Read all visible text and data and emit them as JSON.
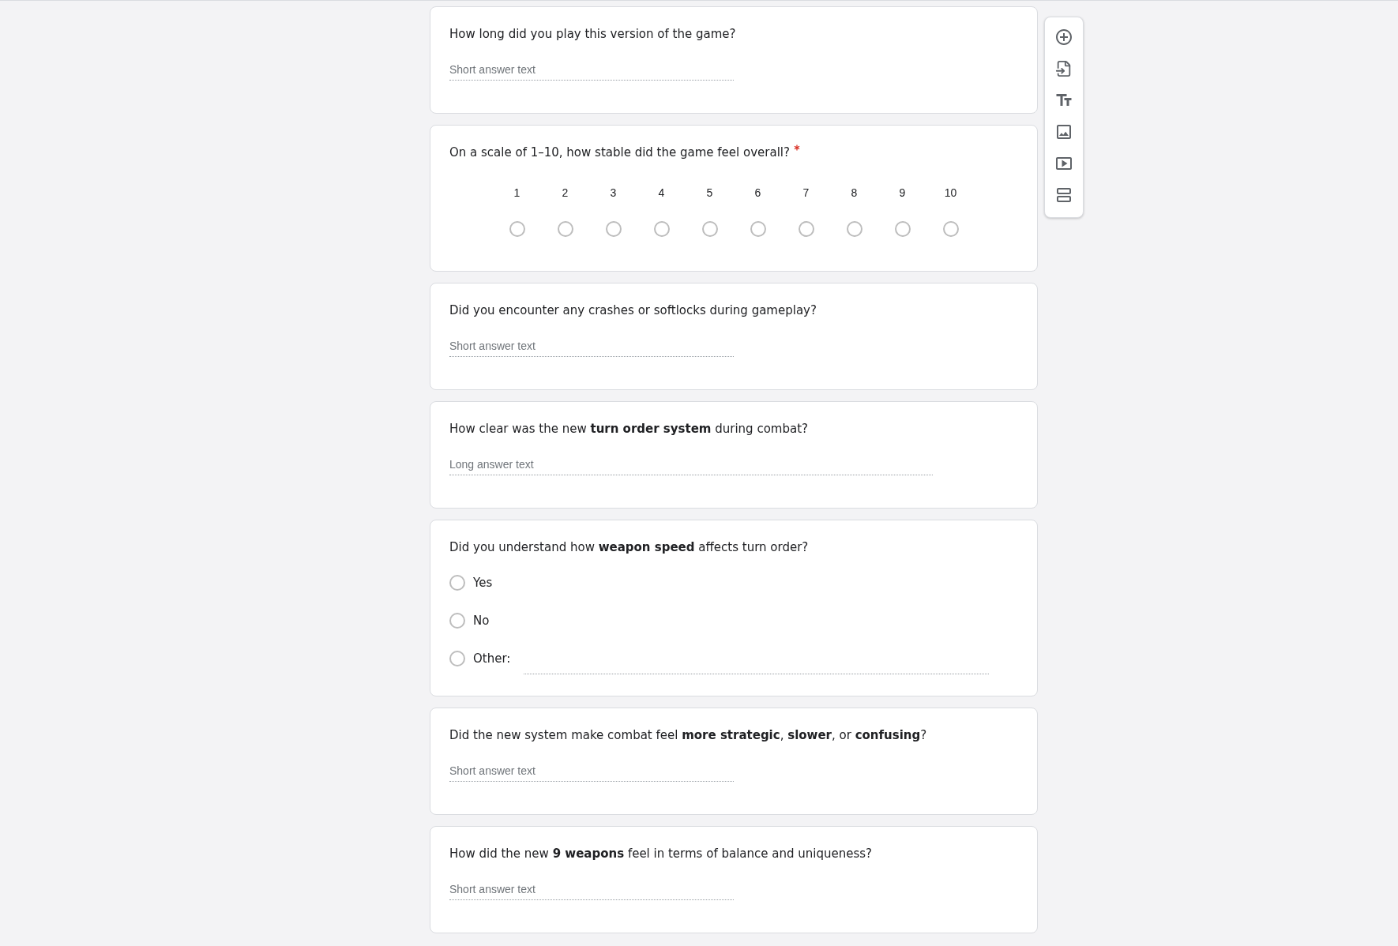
{
  "questions": [
    {
      "kind": "short_answer",
      "title": "How long did you play this version of the game?",
      "required": false,
      "placeholder": "Short answer text"
    },
    {
      "kind": "linear_scale",
      "title": "On a scale of 1–10, how stable did the game feel overall?",
      "required": true,
      "scale": [
        {
          "label": "1",
          "selected": false
        },
        {
          "label": "2",
          "selected": false
        },
        {
          "label": "3",
          "selected": false
        },
        {
          "label": "4",
          "selected": false
        },
        {
          "label": "5",
          "selected": false
        },
        {
          "label": "6",
          "selected": false
        },
        {
          "label": "7",
          "selected": false
        },
        {
          "label": "8",
          "selected": false
        },
        {
          "label": "9",
          "selected": false
        },
        {
          "label": "10",
          "selected": false
        }
      ]
    },
    {
      "kind": "short_answer",
      "title": "Did you encounter any crashes or softlocks during gameplay?",
      "required": false,
      "placeholder": "Short answer text"
    },
    {
      "kind": "paragraph",
      "title": "How clear was the new **turn order system** during combat?",
      "required": false,
      "placeholder": "Long answer text"
    },
    {
      "kind": "multiple_choice",
      "title": "Did you understand how **weapon speed** affects turn order?",
      "required": false,
      "options": [
        {
          "kind": "option",
          "label": "Yes",
          "selected": false
        },
        {
          "kind": "option",
          "label": "No",
          "selected": false
        },
        {
          "kind": "other",
          "label": "Other:",
          "selected": false
        }
      ]
    },
    {
      "kind": "short_answer",
      "title": "Did the new system make combat feel **more strategic**, **slower**, or **confusing**?",
      "required": false,
      "placeholder": "Short answer text"
    },
    {
      "kind": "short_answer",
      "title": "How did the new **9 weapons** feel in terms of balance and uniqueness?",
      "required": false,
      "placeholder": "Short answer text"
    }
  ]
}
